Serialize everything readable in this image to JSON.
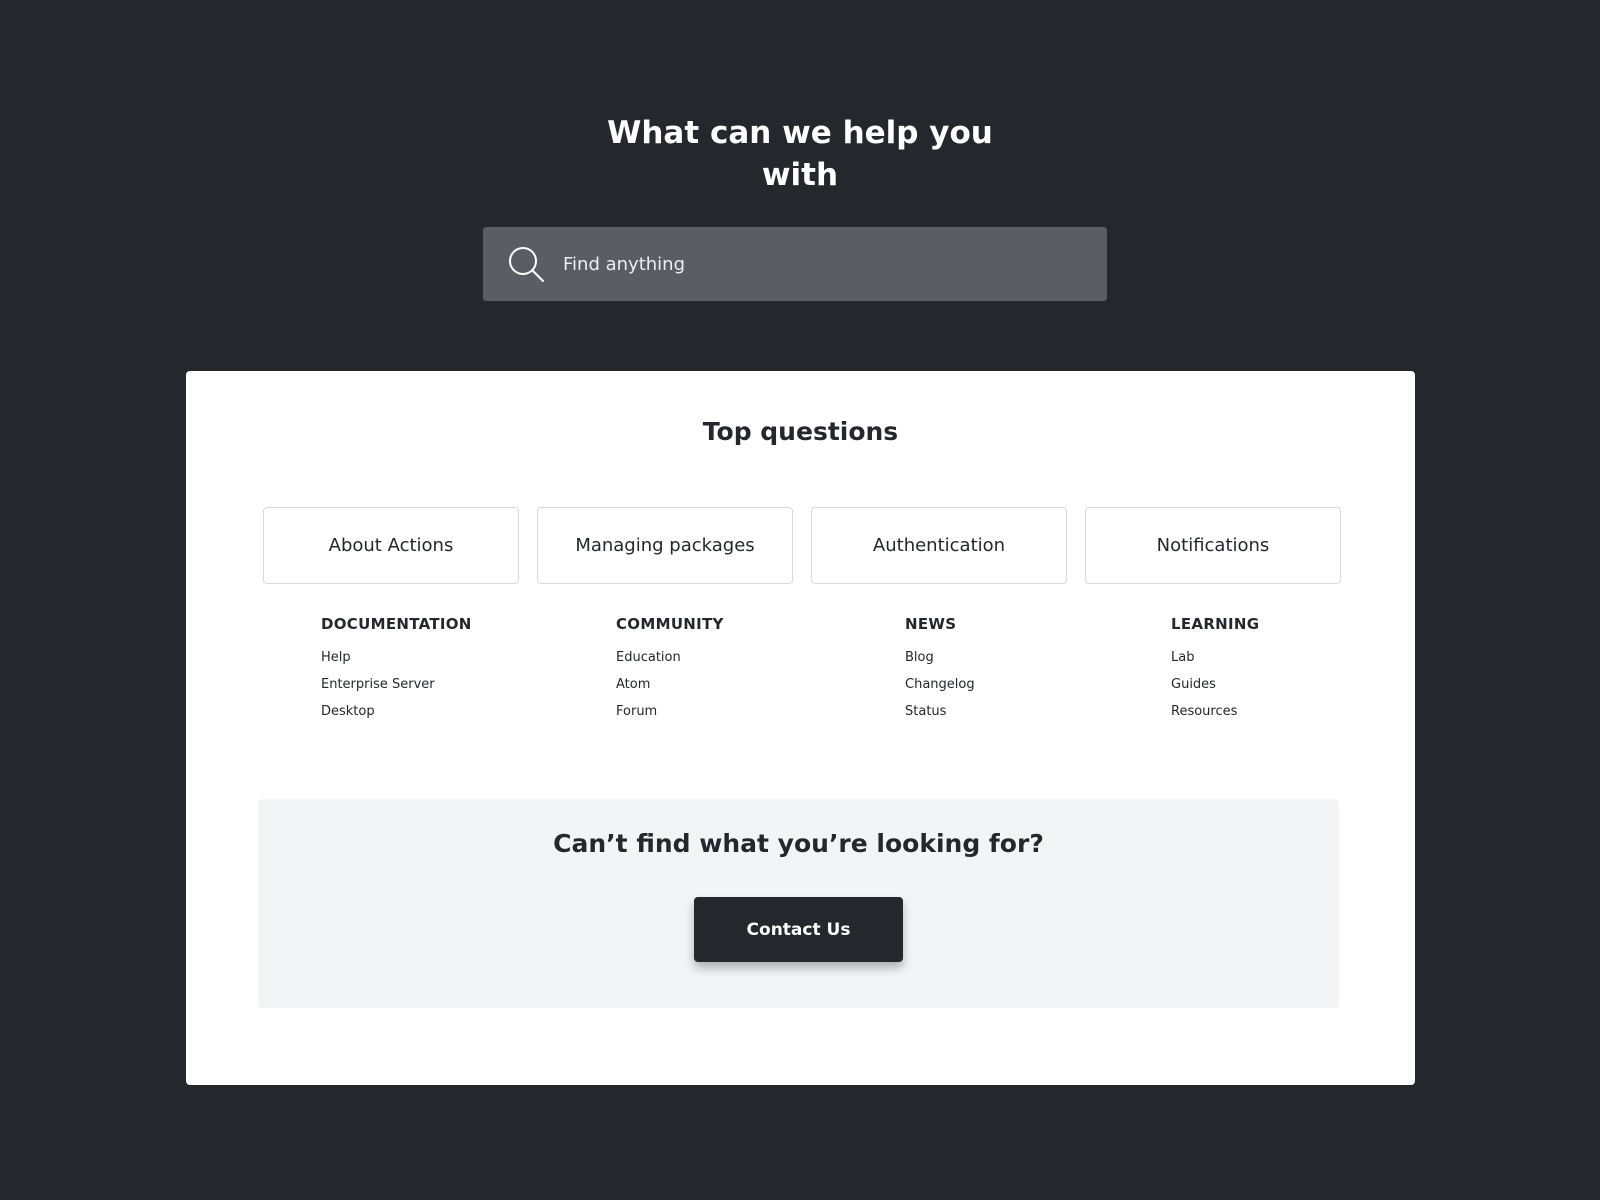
{
  "hero": {
    "title_line1": "What can we help you",
    "title_line2": "with"
  },
  "search": {
    "placeholder": "Find anything",
    "value": "",
    "icon": "search-icon"
  },
  "top_questions": {
    "title": "Top questions",
    "items": [
      {
        "label": "About Actions"
      },
      {
        "label": "Managing packages"
      },
      {
        "label": "Authentication"
      },
      {
        "label": "Notifications"
      }
    ]
  },
  "link_columns": [
    {
      "heading": "DOCUMENTATION",
      "links": [
        "Help",
        "Enterprise Server",
        "Desktop"
      ]
    },
    {
      "heading": "COMMUNITY",
      "links": [
        "Education",
        "Atom",
        "Forum"
      ]
    },
    {
      "heading": "NEWS",
      "links": [
        "Blog",
        "Changelog",
        "Status"
      ]
    },
    {
      "heading": "LEARNING",
      "links": [
        "Lab",
        "Guides",
        "Resources"
      ]
    }
  ],
  "cta": {
    "title": "Can’t find what you’re looking for?",
    "button_label": "Contact Us"
  },
  "colors": {
    "page_background": "#24272c",
    "search_background": "#5a5e64",
    "card_background": "#ffffff",
    "cta_background": "#f3f4f6",
    "button_background": "#24272c",
    "text_dark": "#24272c",
    "text_light": "#ffffff"
  }
}
